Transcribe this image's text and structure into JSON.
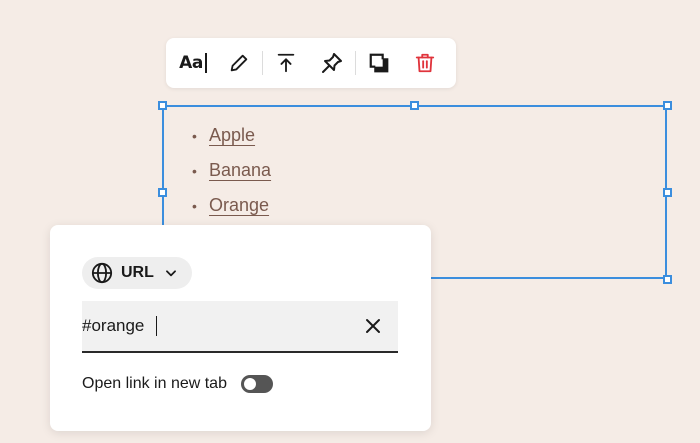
{
  "toolbar": {
    "text_style_label": "Aa",
    "tools": [
      "text-style",
      "edit",
      "move-to-top",
      "pin",
      "duplicate",
      "delete"
    ]
  },
  "list": {
    "items": [
      "Apple",
      "Banana",
      "Orange"
    ]
  },
  "link_popover": {
    "type_label": "URL",
    "url_value": "#orange",
    "new_tab_label": "Open link in new tab",
    "new_tab_enabled": false
  },
  "colors": {
    "background": "#f5ece6",
    "selection": "#3b8ede",
    "link_text": "#7a5a4e",
    "delete": "#e0343c"
  }
}
